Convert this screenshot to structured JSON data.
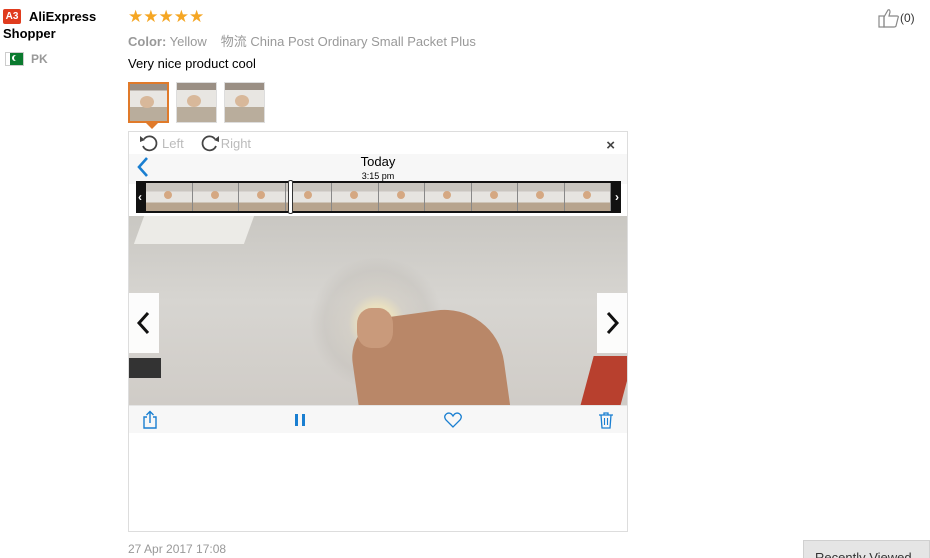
{
  "user": {
    "level_badge": "A3",
    "name_line1": "AliExpress",
    "name_line2": "Shopper",
    "country_code": "PK"
  },
  "review": {
    "stars": "★★★★★",
    "color_label": "Color:",
    "color_value": "Yellow",
    "shipping_label": "物流",
    "shipping_value": "China Post Ordinary Small Packet Plus",
    "text": "Very nice product cool",
    "date": "27 Apr 2017 17:08",
    "helpful_count": "(0)"
  },
  "viewer": {
    "rotate_left": "Left",
    "rotate_right": "Right",
    "close": "×",
    "photo_title": "Today",
    "photo_time": "3:15 pm"
  },
  "floating": {
    "recently_viewed": "Recently Viewed"
  },
  "colors": {
    "star": "#f5a623",
    "badge": "#e03c1e",
    "ios_blue": "#1a7fd1",
    "thumb_active_border": "#e07a2a"
  }
}
